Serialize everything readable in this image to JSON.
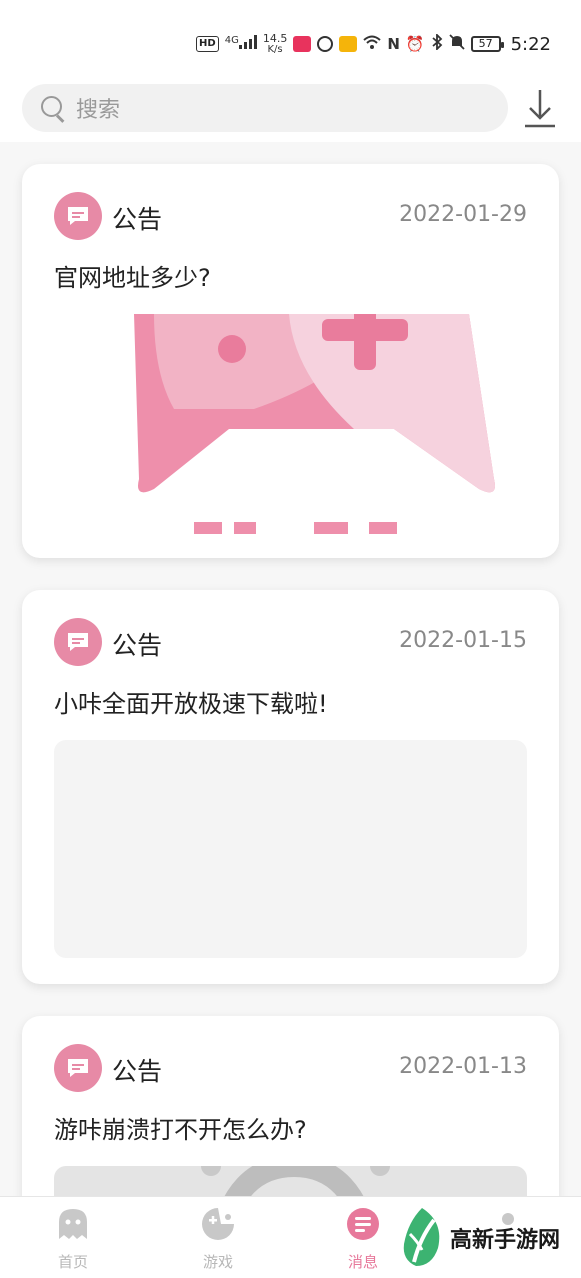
{
  "status_bar": {
    "network_badge": "HD",
    "signal": "4G",
    "speed_value": "14.5",
    "speed_unit": "K/s",
    "battery": "57",
    "time": "5:22"
  },
  "search": {
    "placeholder": "搜索"
  },
  "posts": [
    {
      "category": "公告",
      "date": "2022-01-29",
      "title": "官网地址多少?"
    },
    {
      "category": "公告",
      "date": "2022-01-15",
      "title": "小咔全面开放极速下载啦!"
    },
    {
      "category": "公告",
      "date": "2022-01-13",
      "title": "游咔崩溃打不开怎么办?"
    }
  ],
  "nav": {
    "items": [
      {
        "label": "首页",
        "icon": "ghost-icon"
      },
      {
        "label": "游戏",
        "icon": "gamepad-icon"
      },
      {
        "label": "消息",
        "icon": "message-icon"
      }
    ],
    "active_index": 2
  },
  "watermark": {
    "text": "高新手游网"
  },
  "colors": {
    "accent": "#e7799b",
    "notice_icon_bg": "#e78aa6",
    "card_bg": "#ffffff",
    "page_bg": "#f7f7f7"
  }
}
